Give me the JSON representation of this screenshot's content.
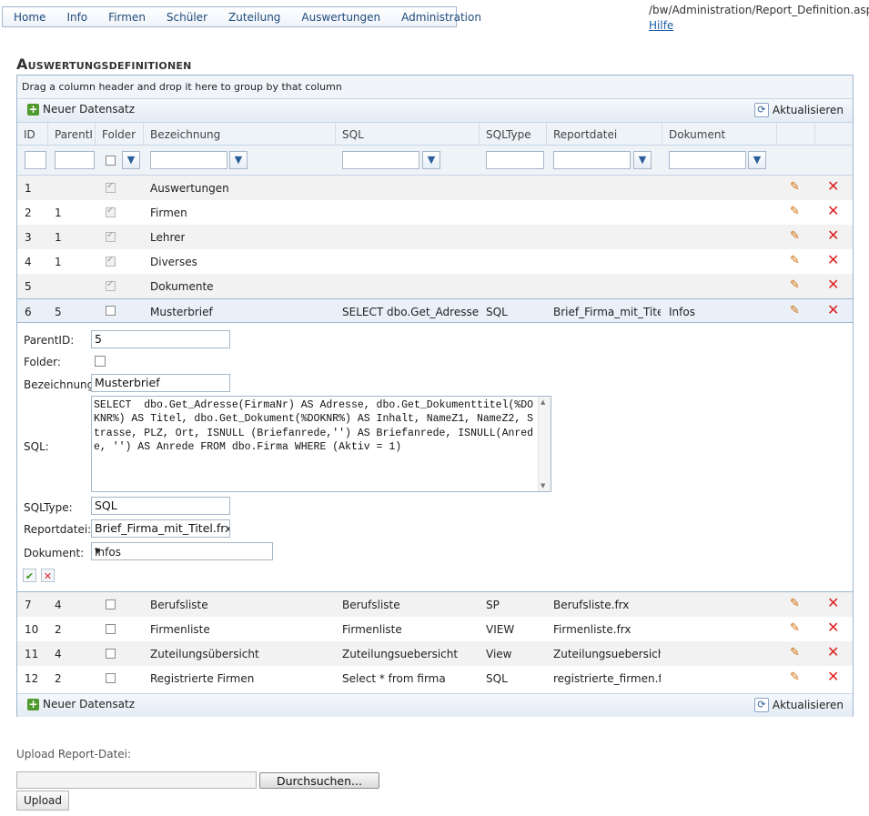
{
  "nav": {
    "items": [
      "Home",
      "Info",
      "Firmen",
      "Schüler",
      "Zuteilung",
      "Auswertungen",
      "Administration"
    ]
  },
  "page": {
    "path": "/bw/Administration/Report_Definition.aspx",
    "help": "Hilfe",
    "title": "Auswertungsdefinitionen"
  },
  "grid": {
    "group_hint": "Drag a column header and drop it here to group by that column",
    "add_label": "Neuer Datensatz",
    "refresh_label": "Aktualisieren",
    "columns": [
      "ID",
      "ParentID",
      "Folder",
      "Bezeichnung",
      "SQL",
      "SQLType",
      "Reportdatei",
      "Dokument"
    ],
    "rows_top": [
      {
        "id": "1",
        "parent": "",
        "folder": true,
        "name": "Auswertungen",
        "sql": "",
        "type": "",
        "file": "",
        "doc": ""
      },
      {
        "id": "2",
        "parent": "1",
        "folder": true,
        "name": "Firmen",
        "sql": "",
        "type": "",
        "file": "",
        "doc": ""
      },
      {
        "id": "3",
        "parent": "1",
        "folder": true,
        "name": "Lehrer",
        "sql": "",
        "type": "",
        "file": "",
        "doc": ""
      },
      {
        "id": "4",
        "parent": "1",
        "folder": true,
        "name": "Diverses",
        "sql": "",
        "type": "",
        "file": "",
        "doc": ""
      },
      {
        "id": "5",
        "parent": "",
        "folder": true,
        "name": "Dokumente",
        "sql": "",
        "type": "",
        "file": "",
        "doc": ""
      },
      {
        "id": "6",
        "parent": "5",
        "folder": false,
        "name": "Musterbrief",
        "sql": "SELECT dbo.Get_Adresse(Firn",
        "type": "SQL",
        "file": "Brief_Firma_mit_Titel.fr",
        "doc": "Infos"
      }
    ],
    "rows_bottom": [
      {
        "id": "7",
        "parent": "4",
        "folder": false,
        "name": "Berufsliste",
        "sql": "Berufsliste",
        "type": "SP",
        "file": "Berufsliste.frx",
        "doc": ""
      },
      {
        "id": "10",
        "parent": "2",
        "folder": false,
        "name": "Firmenliste",
        "sql": "Firmenliste",
        "type": "VIEW",
        "file": "Firmenliste.frx",
        "doc": ""
      },
      {
        "id": "11",
        "parent": "4",
        "folder": false,
        "name": "Zuteilungsübersicht",
        "sql": "Zuteilungsuebersicht",
        "type": "View",
        "file": "Zuteilungsuebersicht.f",
        "doc": ""
      },
      {
        "id": "12",
        "parent": "2",
        "folder": false,
        "name": "Registrierte Firmen",
        "sql": "Select * from firma",
        "type": "SQL",
        "file": "registrierte_firmen.frx",
        "doc": ""
      }
    ]
  },
  "edit": {
    "labels": {
      "parent": "ParentID:",
      "folder": "Folder:",
      "name": "Bezeichnung:",
      "sql": "SQL:",
      "type": "SQLType:",
      "file": "Reportdatei:",
      "doc": "Dokument:"
    },
    "parent": "5",
    "name": "Musterbrief",
    "sql": "SELECT  dbo.Get_Adresse(FirmaNr) AS Adresse, dbo.Get_Dokumenttitel(%DOKNR%) AS Titel, dbo.Get_Dokument(%DOKNR%) AS Inhalt, NameZ1, NameZ2, Strasse, PLZ, Ort, ISNULL (Briefanrede,'') AS Briefanrede, ISNULL(Anrede, '') AS Anrede FROM dbo.Firma WHERE (Aktiv = 1)",
    "type": "SQL",
    "file": "Brief_Firma_mit_Titel.frx",
    "doc": "Infos"
  },
  "upload": {
    "label": "Upload Report-Datei:",
    "browse": "Durchsuchen...",
    "button": "Upload"
  },
  "colors": {
    "border": "#9eb6ce",
    "header_bg": "#eef3f8",
    "link": "#1a5ea8",
    "delete": "#dd2222",
    "edit": "#d06a00"
  },
  "icons": [
    "plus-icon",
    "refresh-icon",
    "filter-icon",
    "edit-icon",
    "delete-icon",
    "check-icon",
    "cancel-icon",
    "dropdown-arrow-icon"
  ]
}
